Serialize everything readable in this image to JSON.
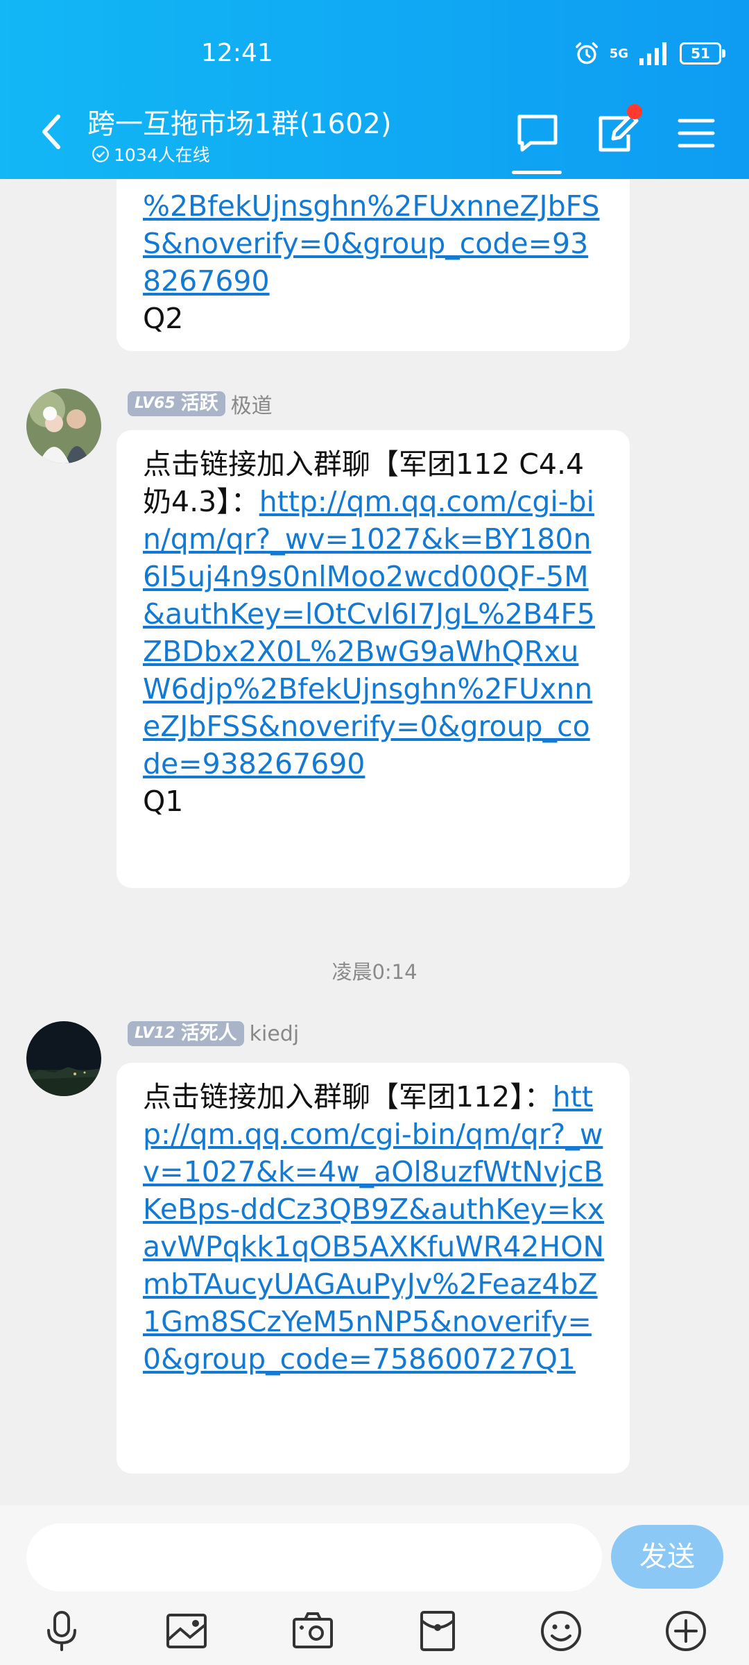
{
  "status": {
    "time": "12:41",
    "network": "5G",
    "battery": "51"
  },
  "header": {
    "title": "跨一互拖市场1群(1602)",
    "online": "1034人在线"
  },
  "messages": [
    {
      "link": "%2BfekUjnsghn%2FUxnneZJbFSS&noverify=0&group_code=938267690",
      "suffix": "Q2"
    },
    {
      "level": "LV65",
      "title": "活跃",
      "nickname": "极道",
      "text": "点击链接加入群聊【军团112 C4.4 奶4.3】：",
      "link": "http://qm.qq.com/cgi-bin/qm/qr?_wv=1027&k=BY180n6I5uj4n9s0nlMoo2wcd00QF-5M&authKey=lOtCvl6I7JgL%2B4F5ZBDbx2X0L%2BwG9aWhQRxuW6djp%2BfekUjnsghn%2FUxnneZJbFSS&noverify=0&group_code=938267690",
      "suffix": "Q1"
    },
    {
      "level": "LV12",
      "title": "活死人",
      "nickname": "kiedj",
      "text": "点击链接加入群聊【军团112】：",
      "link": "http://qm.qq.com/cgi-bin/qm/qr?_wv=1027&k=4w_aOl8uzfWtNvjcBKeBps-ddCz3QB9Z&authKey=kxavWPqkk1qOB5AXKfuWR42HONmbTAucyUAGAuPyJv%2Feaz4bZ1Gm8SCzYeM5nNP5&noverify=0&group_code=758600727Q1",
      "suffix": ""
    }
  ],
  "time_separator": "凌晨0:14",
  "input": {
    "placeholder": "",
    "send_label": "发送"
  },
  "toolbar": [
    "microphone-icon",
    "image-icon",
    "camera-icon",
    "red-packet-icon",
    "emoji-icon",
    "plus-icon"
  ]
}
